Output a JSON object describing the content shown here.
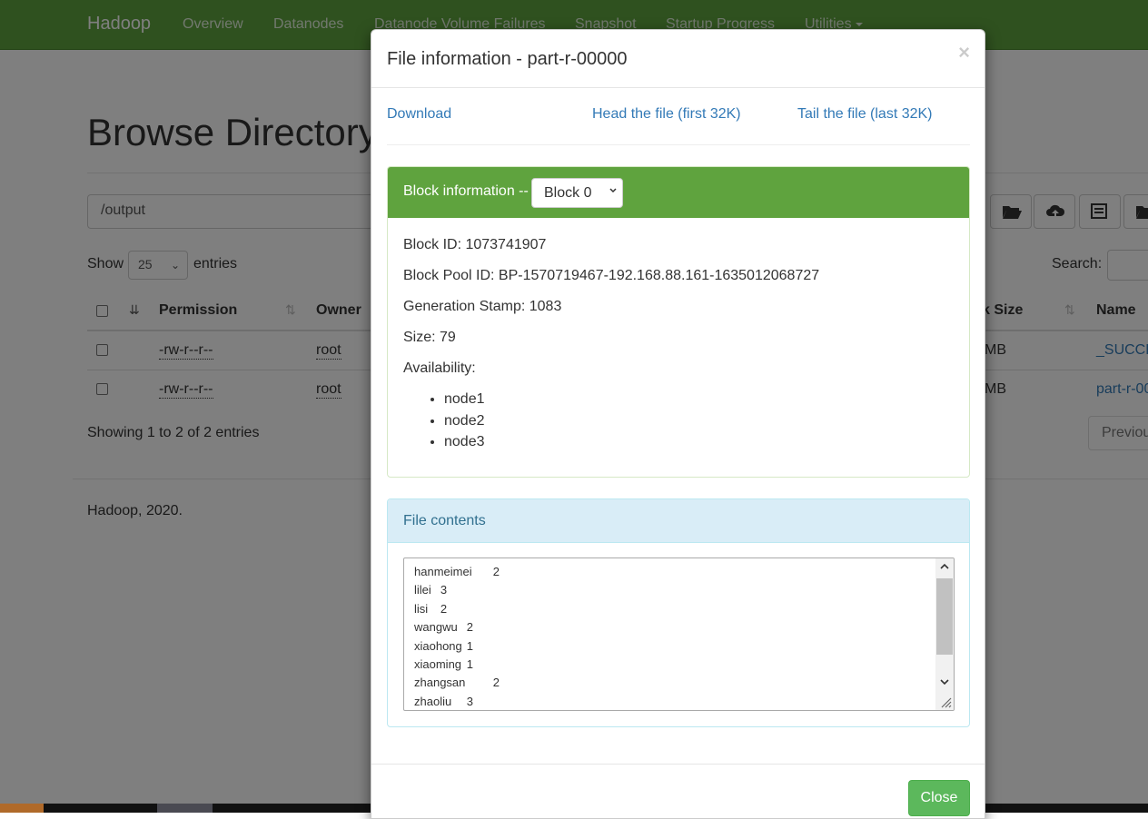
{
  "navbar": {
    "brand": "Hadoop",
    "items": [
      "Overview",
      "Datanodes",
      "Datanode Volume Failures",
      "Snapshot",
      "Startup Progress",
      "Utilities"
    ]
  },
  "page": {
    "title": "Browse Directory",
    "path_value": "/output",
    "show_label": "Show",
    "page_size": "25",
    "entries_label": "entries",
    "search_label": "Search:",
    "columns": [
      "Permission",
      "Owner",
      "k Size",
      "Name"
    ],
    "rows": [
      {
        "permission": "-rw-r--r--",
        "owner": "root",
        "block_size": "MB",
        "name": "_SUCCE"
      },
      {
        "permission": "-rw-r--r--",
        "owner": "root",
        "block_size": "MB",
        "name": "part-r-00"
      }
    ],
    "showing": "Showing 1 to 2 of 2 entries",
    "previous": "Previous",
    "footer": "Hadoop, 2020."
  },
  "modal": {
    "title": "File information - part-r-00000",
    "close_x": "×",
    "links": {
      "download": "Download",
      "head": "Head the file (first 32K)",
      "tail": "Tail the file (last 32K)"
    },
    "block_panel": {
      "title": "Block information --",
      "selected_block": "Block 0",
      "block_id": "Block ID: 1073741907",
      "block_pool_id": "Block Pool ID: BP-1570719467-192.168.88.161-1635012068727",
      "generation_stamp": "Generation Stamp: 1083",
      "size": "Size: 79",
      "availability_label": "Availability:",
      "nodes": [
        "node1",
        "node2",
        "node3"
      ]
    },
    "contents_panel": {
      "title": "File contents",
      "lines": [
        "hanmeimei\t2",
        "lilei\t3",
        "lisi\t2",
        "wangwu\t2",
        "xiaohong\t1",
        "xiaoming\t1",
        "zhangsan\t2",
        "zhaoliu\t3"
      ]
    },
    "close_button": "Close"
  },
  "colors": {
    "navbar": "#5fa33e",
    "panel_green": "#5fa33e",
    "panel_blue": "#d9edf7",
    "link": "#337ab7",
    "close_button": "#5cb85c"
  }
}
